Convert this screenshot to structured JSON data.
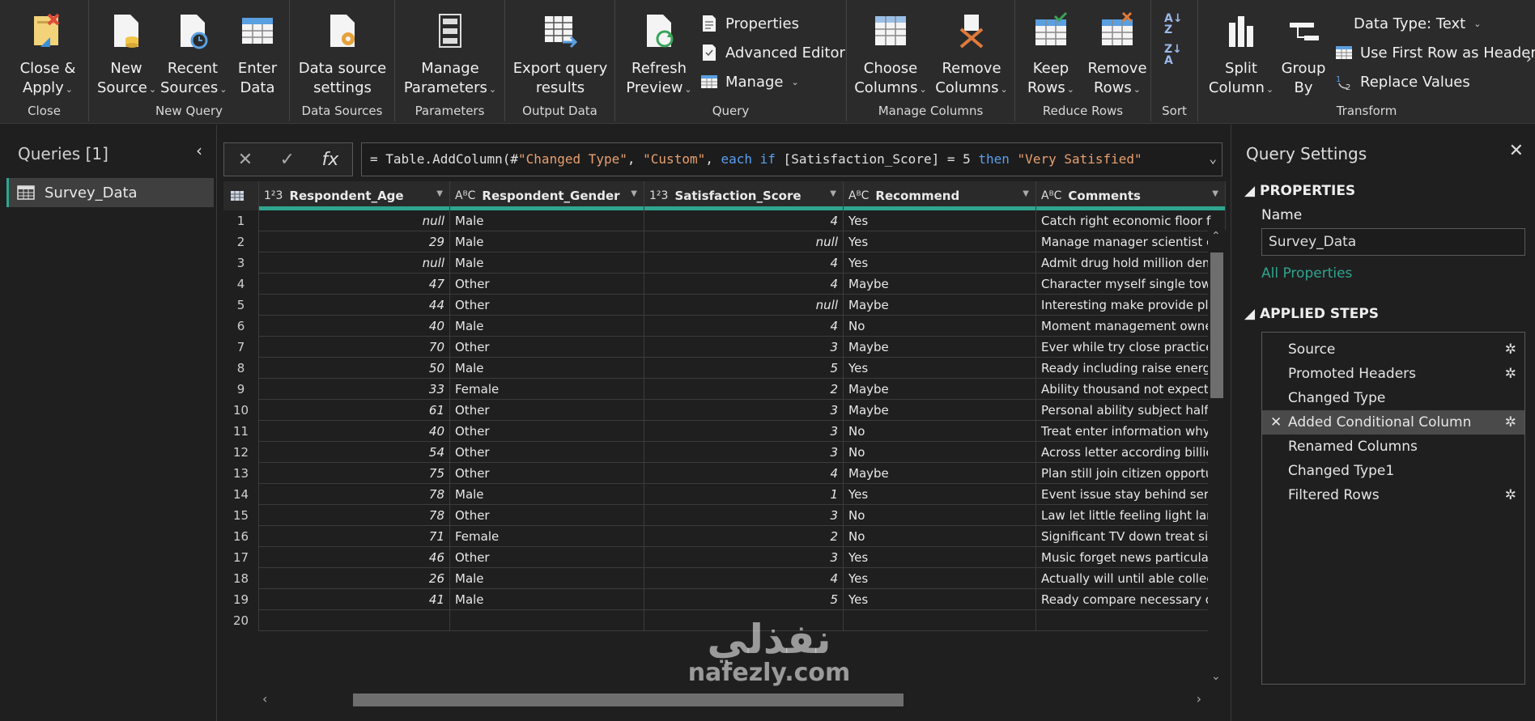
{
  "ribbon": {
    "groups": {
      "close": "Close",
      "new_query": "New Query",
      "data_sources": "Data Sources",
      "parameters": "Parameters",
      "output_data": "Output Data",
      "query": "Query",
      "manage_columns": "Manage Columns",
      "reduce_rows": "Reduce Rows",
      "sort": "Sort",
      "transform": "Transform"
    },
    "buttons": {
      "close_apply": [
        "Close &",
        "Apply"
      ],
      "new_source": [
        "New",
        "Source"
      ],
      "recent_sources": [
        "Recent",
        "Sources"
      ],
      "enter_data": [
        "Enter",
        "Data"
      ],
      "data_source_settings": [
        "Data source",
        "settings"
      ],
      "manage_parameters": [
        "Manage",
        "Parameters"
      ],
      "export_query": [
        "Export query",
        "results"
      ],
      "refresh_preview": [
        "Refresh",
        "Preview"
      ],
      "properties": "Properties",
      "advanced_editor": "Advanced Editor",
      "manage": "Manage",
      "choose_columns": [
        "Choose",
        "Columns"
      ],
      "remove_columns": [
        "Remove",
        "Columns"
      ],
      "keep_rows": [
        "Keep",
        "Rows"
      ],
      "remove_rows": [
        "Remove",
        "Rows"
      ],
      "split_column": [
        "Split",
        "Column"
      ],
      "group_by": [
        "Group",
        "By"
      ],
      "data_type": "Data Type: Text",
      "first_row_headers": "Use First Row as Headers",
      "replace_values": "Replace Values"
    }
  },
  "queries": {
    "title": "Queries [1]",
    "items": [
      "Survey_Data"
    ]
  },
  "formula": {
    "prefix": "= Table.AddColumn(#",
    "arg1": "\"Changed Type\"",
    "sep1": ", ",
    "arg2": "\"Custom\"",
    "sep2": ", ",
    "kw_each": "each",
    "kw_if": "if",
    "cond": " [Satisfaction_Score] = 5 ",
    "kw_then": "then",
    "arg3": "\"Very Satisfied\""
  },
  "grid": {
    "columns": [
      {
        "type": "1²3",
        "name": "Respondent_Age"
      },
      {
        "type": "AᴮC",
        "name": "Respondent_Gender"
      },
      {
        "type": "1²3",
        "name": "Satisfaction_Score"
      },
      {
        "type": "AᴮC",
        "name": "Recommend"
      },
      {
        "type": "AᴮC",
        "name": "Comments"
      }
    ],
    "rows": [
      [
        "1",
        "null",
        "Male",
        "4",
        "Yes",
        "Catch right economic floor f"
      ],
      [
        "2",
        "29",
        "Male",
        "null",
        "Yes",
        "Manage manager scientist c"
      ],
      [
        "3",
        "null",
        "Male",
        "4",
        "Yes",
        "Admit drug hold million dem"
      ],
      [
        "4",
        "47",
        "Other",
        "4",
        "Maybe",
        "Character myself single tow"
      ],
      [
        "5",
        "44",
        "Other",
        "null",
        "Maybe",
        "Interesting make provide pla"
      ],
      [
        "6",
        "40",
        "Male",
        "4",
        "No",
        "Moment management owne"
      ],
      [
        "7",
        "70",
        "Other",
        "3",
        "Maybe",
        "Ever while try close practice"
      ],
      [
        "8",
        "50",
        "Male",
        "5",
        "Yes",
        "Ready including raise energy"
      ],
      [
        "9",
        "33",
        "Female",
        "2",
        "Maybe",
        "Ability thousand not expect"
      ],
      [
        "10",
        "61",
        "Other",
        "3",
        "Maybe",
        "Personal ability subject half"
      ],
      [
        "11",
        "40",
        "Other",
        "3",
        "No",
        "Treat enter information why"
      ],
      [
        "12",
        "54",
        "Other",
        "3",
        "No",
        "Across letter according billic"
      ],
      [
        "13",
        "75",
        "Other",
        "4",
        "Maybe",
        "Plan still join citizen opportu"
      ],
      [
        "14",
        "78",
        "Male",
        "1",
        "Yes",
        "Event issue stay behind seri"
      ],
      [
        "15",
        "78",
        "Other",
        "3",
        "No",
        "Law let little feeling light lar"
      ],
      [
        "16",
        "71",
        "Female",
        "2",
        "No",
        "Significant TV down treat sir"
      ],
      [
        "17",
        "46",
        "Other",
        "3",
        "Yes",
        "Music forget news particula"
      ],
      [
        "18",
        "26",
        "Male",
        "4",
        "Yes",
        "Actually will until able collec"
      ],
      [
        "19",
        "41",
        "Male",
        "5",
        "Yes",
        "Ready compare necessary o"
      ],
      [
        "20",
        "",
        "",
        "",
        "",
        ""
      ]
    ]
  },
  "settings": {
    "title": "Query Settings",
    "properties_title": "PROPERTIES",
    "name_label": "Name",
    "name_value": "Survey_Data",
    "all_properties": "All Properties",
    "steps_title": "APPLIED STEPS",
    "steps": [
      {
        "label": "Source",
        "gear": true
      },
      {
        "label": "Promoted Headers",
        "gear": true
      },
      {
        "label": "Changed Type",
        "gear": false
      },
      {
        "label": "Added Conditional Column",
        "gear": true,
        "selected": true
      },
      {
        "label": "Renamed Columns",
        "gear": false
      },
      {
        "label": "Changed Type1",
        "gear": false
      },
      {
        "label": "Filtered Rows",
        "gear": true
      }
    ]
  },
  "watermark": {
    "line1": "نفذلي",
    "line2": "nafezly.com"
  },
  "colors": {
    "accent": "#2fa58f",
    "background": "#1f1f1f",
    "ribbon": "#2b2b2b"
  }
}
